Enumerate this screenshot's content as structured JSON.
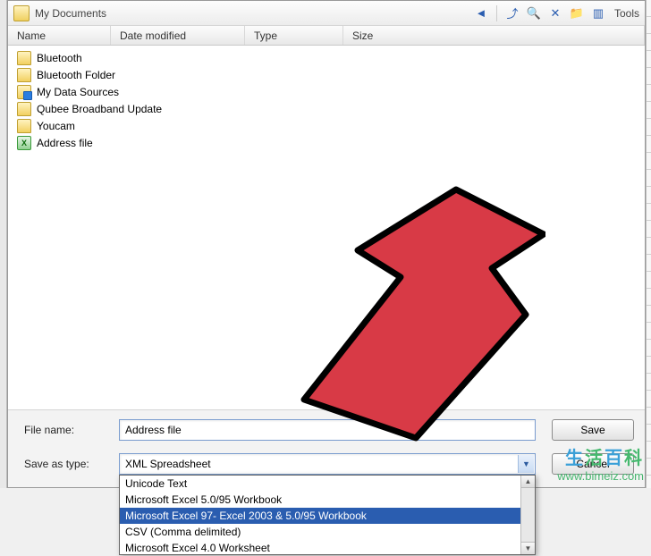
{
  "toolbar": {
    "location": "My Documents",
    "tools_label": "Tools"
  },
  "columns": {
    "name": "Name",
    "date": "Date modified",
    "type": "Type",
    "size": "Size"
  },
  "files": [
    {
      "icon": "folder",
      "label": "Bluetooth"
    },
    {
      "icon": "folder",
      "label": "Bluetooth Folder"
    },
    {
      "icon": "datasource",
      "label": "My Data Sources"
    },
    {
      "icon": "folder",
      "label": "Qubee Broadband Update"
    },
    {
      "icon": "folder",
      "label": "Youcam"
    },
    {
      "icon": "excel",
      "label": "Address file"
    }
  ],
  "fields": {
    "filename_label": "File name:",
    "filename_value": "Address file",
    "savetype_label": "Save as type:",
    "savetype_value": "XML Spreadsheet"
  },
  "buttons": {
    "save": "Save",
    "cancel": "Cancel"
  },
  "dropdown": {
    "items": [
      {
        "label": "Unicode Text",
        "selected": false
      },
      {
        "label": "Microsoft Excel 5.0/95 Workbook",
        "selected": false
      },
      {
        "label": "Microsoft Excel 97- Excel 2003 & 5.0/95 Workbook",
        "selected": true
      },
      {
        "label": "CSV (Comma delimited)",
        "selected": false
      },
      {
        "label": "Microsoft Excel 4.0 Worksheet",
        "selected": false
      }
    ]
  },
  "watermark": {
    "title": "生活百科",
    "url": "www.bimeiz.com"
  }
}
